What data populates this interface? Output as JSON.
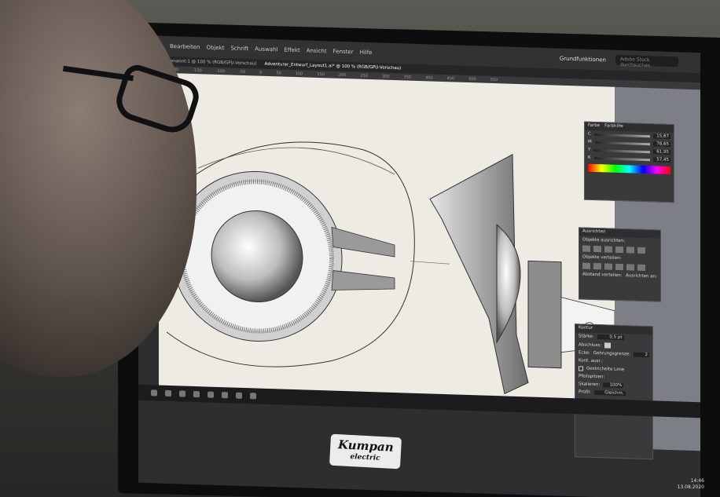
{
  "menubar": {
    "items": [
      "Bearbeiten",
      "Objekt",
      "Schrift",
      "Auswahl",
      "Effekt",
      "Ansicht",
      "Fenster",
      "Hilfe"
    ],
    "workspace": "Grundfunktionen",
    "search_placeholder": "Adobe Stock durchsuchen"
  },
  "tabbar": {
    "tabs": [
      "Unbenannt-1 @ 100 % (RGB/GPU-Vorschau)",
      "Adventurer_Entwurf_Layout1.ai* @ 100 % (RGB/GPU-Vorschau)"
    ]
  },
  "ruler": {
    "ticks": [
      "-200",
      "-150",
      "-100",
      "-50",
      "0",
      "50",
      "100",
      "150",
      "200",
      "250",
      "300",
      "350",
      "400",
      "450",
      "500",
      "550"
    ]
  },
  "panels": {
    "color": {
      "tabs": [
        "Farbe",
        "Farbhilfe"
      ],
      "channels": [
        {
          "label": "C",
          "value": "15,67"
        },
        {
          "label": "M",
          "value": "78,65"
        },
        {
          "label": "Y",
          "value": "61,95"
        },
        {
          "label": "K",
          "value": "57,45"
        }
      ]
    },
    "align": {
      "title": "Ausrichten",
      "sections": [
        "Objekte ausrichten:",
        "Objekte verteilen:",
        "Abstand verteilen:",
        "Ausrichten an:"
      ]
    },
    "stroke": {
      "title": "Kontur",
      "weight_label": "Stärke:",
      "weight_value": "0,5 pt",
      "cap_label": "Abschluss:",
      "corner_label": "Ecke:",
      "limit_label": "Gehrungsgrenze:",
      "limit_value": "2",
      "align_label": "Kont. ausr.:",
      "dashed_label": "Gestrichelte Linie",
      "arrow_label": "Pfeilspitzen:",
      "scale_label": "Skalieren:",
      "scale_value": "100%",
      "profile_label": "Profil:",
      "profile_value": "Gleichm."
    }
  },
  "clock": {
    "time": "14:46",
    "date": "13.08.2020"
  },
  "brand": {
    "line1": "Kumpan",
    "line2": "electric"
  }
}
